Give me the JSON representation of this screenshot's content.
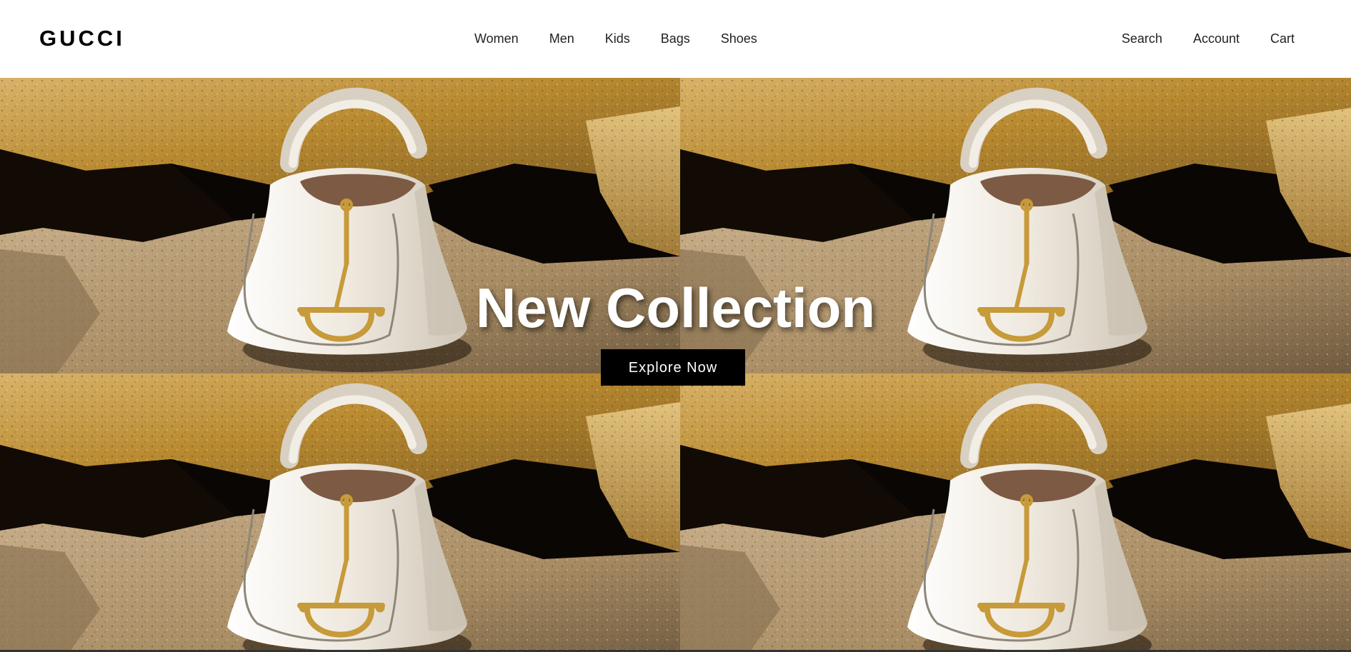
{
  "header": {
    "logo": "GUCCI",
    "nav_main": [
      "Women",
      "Men",
      "Kids",
      "Bags",
      "Shoes"
    ],
    "nav_right": [
      "Search",
      "Account",
      "Cart"
    ]
  },
  "hero": {
    "title": "New Collection",
    "cta_label": "Explore Now",
    "image_subject": "white leather hobo handbag with gold horsebit hardware on sunlit rocks",
    "tiles": 4
  },
  "colors": {
    "header_bg": "#ffffff",
    "logo": "#000000",
    "nav_text": "#222222",
    "cta_bg": "#000000",
    "cta_text": "#ffffff",
    "rock_gold": "#b8892f",
    "rock_shadow": "#0a0604",
    "bag_cream": "#ece5d8",
    "hardware_gold": "#c79a3a"
  }
}
